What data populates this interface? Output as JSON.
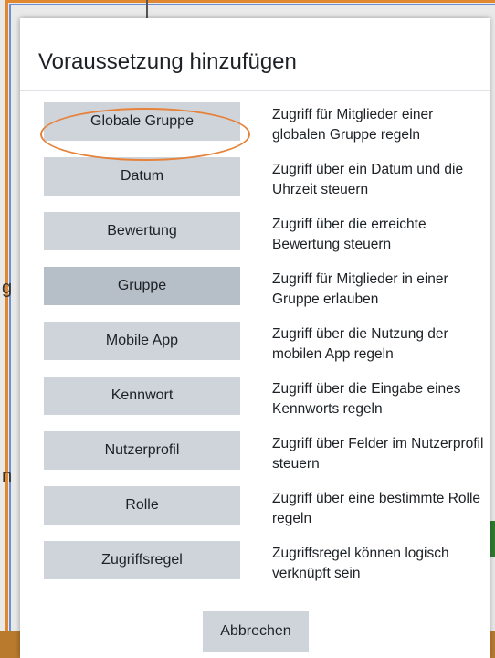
{
  "modal": {
    "title": "Voraussetzung hinzufügen",
    "cancel_label": "Abbrechen",
    "rows": [
      {
        "label": "Globale Gruppe",
        "description": "Zugriff für Mitglieder einer globalen Gruppe regeln"
      },
      {
        "label": "Datum",
        "description": "Zugriff über ein Datum und die Uhrzeit steuern"
      },
      {
        "label": "Bewertung",
        "description": "Zugriff über die erreichte Bewertung steuern"
      },
      {
        "label": "Gruppe",
        "description": "Zugriff für Mitglieder in einer Gruppe erlauben"
      },
      {
        "label": "Mobile App",
        "description": "Zugriff über die Nutzung der mobilen App regeln"
      },
      {
        "label": "Kennwort",
        "description": "Zugriff über die Eingabe eines Kennworts regeln"
      },
      {
        "label": "Nutzerprofil",
        "description": "Zugriff über Felder im Nutzerprofil steuern"
      },
      {
        "label": "Rolle",
        "description": "Zugriff über eine bestimmte Rolle regeln"
      },
      {
        "label": "Zugriffsregel",
        "description": "Zugriffsregel können logisch verknüpft sein"
      }
    ]
  },
  "background": {
    "partial_text_left_1": "g",
    "partial_text_left_2": "n"
  },
  "colors": {
    "button_bg": "#ced4da",
    "button_active_bg": "#b6bec7",
    "highlight_ring": "#e6823a"
  }
}
